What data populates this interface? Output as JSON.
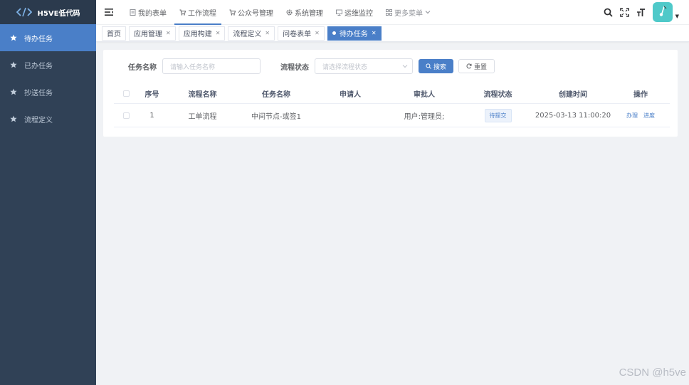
{
  "app": {
    "logo_text": "H5VE低代码"
  },
  "sidebar": {
    "items": [
      {
        "label": "待办任务",
        "active": true
      },
      {
        "label": "已办任务",
        "active": false
      },
      {
        "label": "抄送任务",
        "active": false
      },
      {
        "label": "流程定义",
        "active": false
      }
    ]
  },
  "topnav": {
    "items": [
      {
        "label": "我的表单",
        "icon": "form-icon"
      },
      {
        "label": "工作流程",
        "icon": "cart-icon",
        "active": true
      },
      {
        "label": "公众号管理",
        "icon": "cart-icon"
      },
      {
        "label": "系统管理",
        "icon": "gear-icon"
      },
      {
        "label": "运维监控",
        "icon": "monitor-icon"
      },
      {
        "label": "更多菜单",
        "icon": "grid-icon"
      }
    ]
  },
  "tabs": [
    {
      "label": "首页",
      "closable": false
    },
    {
      "label": "应用管理",
      "closable": true
    },
    {
      "label": "应用构建",
      "closable": true
    },
    {
      "label": "流程定义",
      "closable": true
    },
    {
      "label": "问卷表单",
      "closable": true
    },
    {
      "label": "待办任务",
      "closable": true,
      "active": true
    }
  ],
  "filters": {
    "task_name_label": "任务名称",
    "task_name_placeholder": "请输入任务名称",
    "status_label": "流程状态",
    "status_placeholder": "请选择流程状态",
    "search_label": "搜索",
    "reset_label": "重置"
  },
  "table": {
    "headers": [
      "序号",
      "流程名称",
      "任务名称",
      "申请人",
      "审批人",
      "流程状态",
      "创建时间",
      "操作"
    ],
    "rows": [
      {
        "index": "1",
        "process_name": "工单流程",
        "task_name": "中间节点-或签1",
        "applicant": "",
        "approver": "用户:管理员;",
        "status": "待提交",
        "created": "2025-03-13 11:00:20",
        "actions": [
          "办理",
          "进度"
        ]
      }
    ]
  },
  "watermark": "CSDN @h5ve",
  "colors": {
    "sidebar": "#304156",
    "accent": "#4a7fc8",
    "avatar": "#4fc9c9"
  }
}
